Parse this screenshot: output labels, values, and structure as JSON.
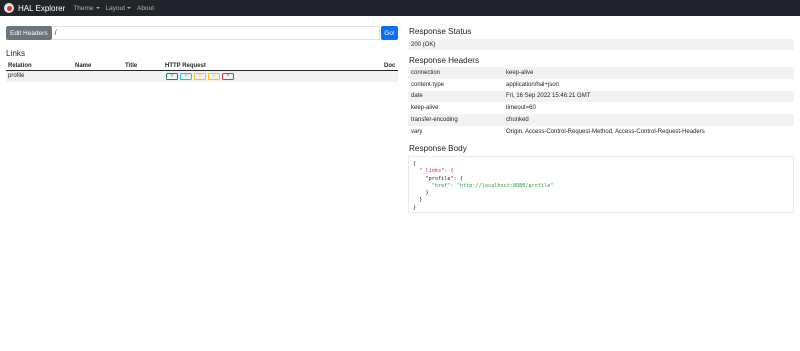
{
  "navbar": {
    "brand": "HAL Explorer",
    "items": [
      {
        "label": "Theme",
        "dropdown": true
      },
      {
        "label": "Layout",
        "dropdown": true
      },
      {
        "label": "About",
        "dropdown": false
      }
    ]
  },
  "request": {
    "edit_headers_label": "Edit Headers",
    "url_value": "/",
    "go_label": "Go!"
  },
  "links": {
    "title": "Links",
    "columns": [
      "Relation",
      "Name",
      "Title",
      "HTTP Request",
      "Doc"
    ],
    "rows": [
      {
        "relation": "profile",
        "name": "",
        "title": "",
        "doc": ""
      }
    ],
    "http_buttons": [
      {
        "method": "GET",
        "glyph": "<",
        "color": "#198754"
      },
      {
        "method": "POST",
        "glyph": "+",
        "color": "#0dcaf0"
      },
      {
        "method": "PUT",
        "glyph": "»",
        "color": "#ffc107"
      },
      {
        "method": "PATCH",
        "glyph": "»",
        "color": "#ffc107"
      },
      {
        "method": "DELETE",
        "glyph": "×",
        "color": "#dc3545"
      }
    ]
  },
  "response_status": {
    "title": "Response Status",
    "value": "200 (OK)"
  },
  "response_headers": {
    "title": "Response Headers",
    "rows": [
      {
        "key": "connection",
        "value": "keep-alive"
      },
      {
        "key": "content-type",
        "value": "application/hal+json"
      },
      {
        "key": "date",
        "value": "Fri, 16 Sep 2022 15:46:21 GMT"
      },
      {
        "key": "keep-alive",
        "value": "timeout=60"
      },
      {
        "key": "transfer-encoding",
        "value": "chunked"
      },
      {
        "key": "vary",
        "value": "Origin, Access-Control-Request-Method, Access-Control-Request-Headers"
      }
    ]
  },
  "response_body": {
    "title": "Response Body",
    "lines": [
      "{",
      "  \"_links\": {",
      "    \"profile\": {",
      "      \"href\": \"http://localhost:8080/profile\"",
      "    }",
      "  }",
      "}"
    ]
  }
}
